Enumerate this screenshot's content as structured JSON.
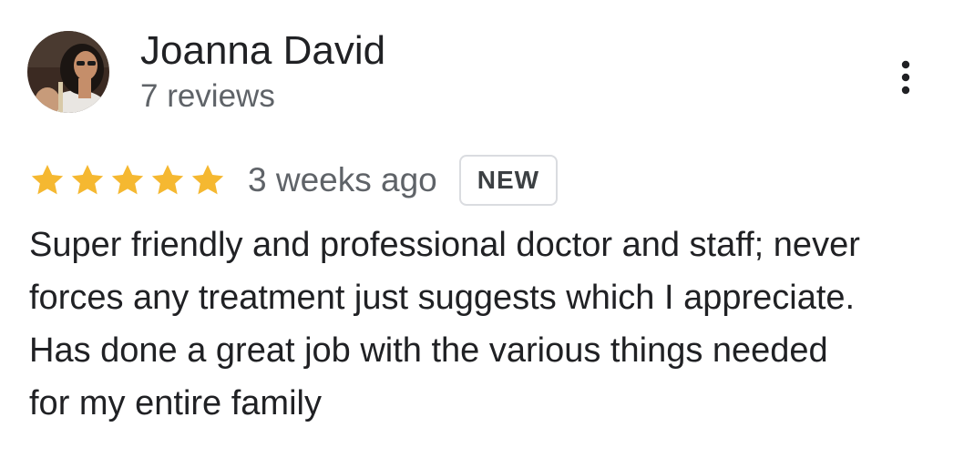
{
  "reviewer": {
    "name": "Joanna David",
    "review_count": "7 reviews",
    "avatar_icon": "profile-photo"
  },
  "menu": {
    "icon": "more-vert-icon"
  },
  "rating": {
    "stars": 5,
    "max_stars": 5,
    "star_color": "#f5b831"
  },
  "review": {
    "time_ago": "3 weeks ago",
    "badge": "NEW",
    "lines": [
      "Super friendly and professional doctor and staff; never",
      "forces any treatment just suggests which I appreciate.",
      "Has done a great job with the various things needed",
      "for my entire family"
    ]
  }
}
